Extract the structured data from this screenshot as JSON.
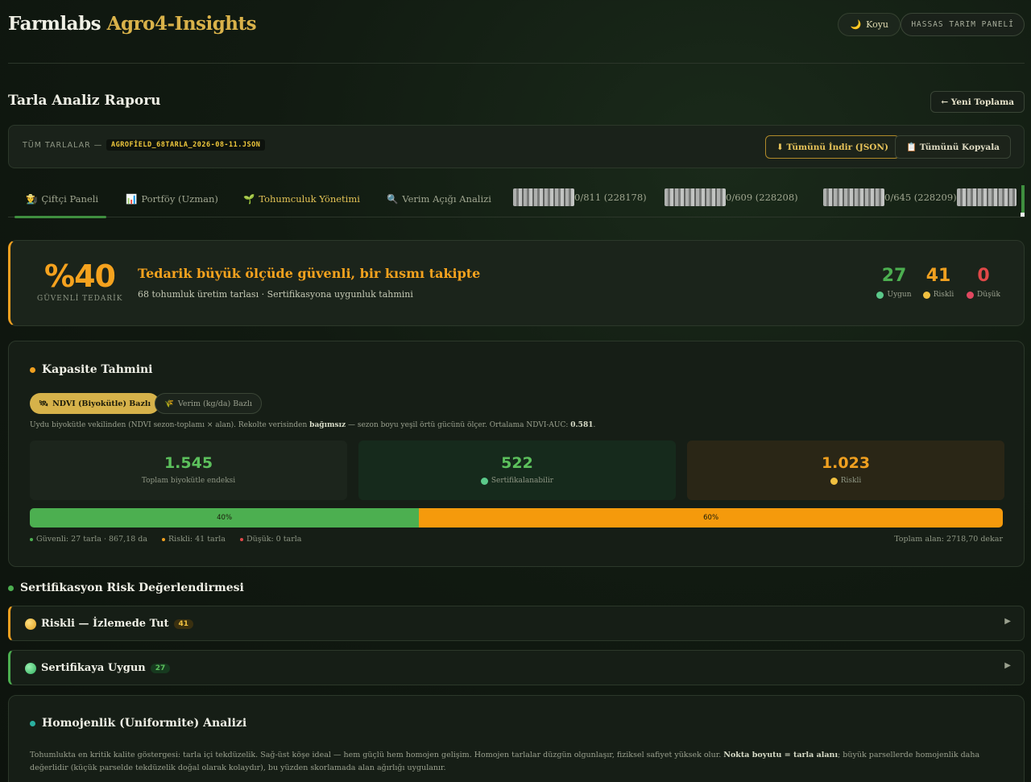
{
  "header": {
    "brand_main": "Farmlabs",
    "brand_accent": "Agro4-Insights",
    "theme_icon": "🌙",
    "theme_label": "Koyu",
    "panel_label": "HASSAS TARIM PANELİ"
  },
  "report": {
    "title": "Tarla Analiz Raporu",
    "new_button": "← Yeni Toplama"
  },
  "filebar": {
    "label": "TÜM TARLALAR —",
    "filename": "AGROFİELD_68TARLA_2026-08-11.JSON",
    "download_button": "⬇ Tümünü İndir (JSON)",
    "copy_button": "📋 Tümünü Kopyala"
  },
  "tabs": [
    {
      "icon": "👨‍🌾",
      "label": "Çiftçi Paneli"
    },
    {
      "icon": "📊",
      "label": "Portföy (Uzman)"
    },
    {
      "icon": "🌱",
      "label": "Tohumculuk Yönetimi"
    },
    {
      "icon": "🔍",
      "label": "Verim Açığı Analizi"
    },
    {
      "label": "0/811 (228178)"
    },
    {
      "label": "0/609 (228208)"
    },
    {
      "label": "0/645 (228209)"
    }
  ],
  "hero": {
    "percent": "%40",
    "percent_label": "GÜVENLİ TEDARİK",
    "headline": "Tedarik büyük ölçüde güvenli, bir kısmı takipte",
    "subline": "68 tohumluk üretim tarlası · Sertifikasyona uygunluk tahmini",
    "stats": [
      {
        "value": "27",
        "label": "Uygun",
        "color": "#4caf50"
      },
      {
        "value": "41",
        "label": "Riskli",
        "color": "#f0a020"
      },
      {
        "value": "0",
        "label": "Düşük",
        "color": "#e04848"
      }
    ]
  },
  "capacity": {
    "title": "Kapasite Tahmini",
    "toggle_on_icon": "🛰",
    "toggle_on": "NDVI (Biyokütle) Bazlı",
    "toggle_off_icon": "🌾",
    "toggle_off": "Verim (kg/da) Bazlı",
    "desc_a": "Uydu biyokütle vekilinden (NDVI sezon-toplamı × alan). Rekolte verisinden ",
    "desc_b": "bağımsız",
    "desc_c": " — sezon boyu yeşil örtü gücünü ölçer. Ortalama NDVI-AUC: ",
    "desc_d": "0.581",
    "desc_e": ".",
    "kpis": [
      {
        "value": "1.545",
        "label": "Toplam biyokütle endeksi"
      },
      {
        "value": "522",
        "label": "Sertifikalanabilir"
      },
      {
        "value": "1.023",
        "label": "Riskli"
      }
    ],
    "bar": [
      {
        "label": "40%",
        "fraction": 0.4,
        "color": "#4caf50"
      },
      {
        "label": "60%",
        "fraction": 0.6,
        "color": "#f59a0c"
      }
    ],
    "legend": [
      {
        "text": "Güvenli: 27 tarla · 867,18 da",
        "color": "#4caf50"
      },
      {
        "text": "Riskli: 41 tarla",
        "color": "#f0a020"
      },
      {
        "text": "Düşük: 0 tarla",
        "color": "#e04848"
      }
    ],
    "total_area": "Toplam alan: 2718,70 dekar"
  },
  "risk": {
    "title": "Sertifikasyon Risk Değerlendirmesi",
    "groups": [
      {
        "label": "Riskli — İzlemede Tut",
        "count": "41",
        "arrow": "▶"
      },
      {
        "label": "Sertifikaya Uygun",
        "count": "27",
        "arrow": "▶"
      }
    ]
  },
  "uniformity": {
    "title": "Homojenlik (Uniformite) Analizi",
    "desc_a": "Tohumlukta en kritik kalite göstergesi: tarla içi tekdüzelik. Sağ-üst köşe ideal — hem güçlü hem homojen gelişim. Homojen tarlalar düzgün olgunlaşır, fiziksel safiyet yüksek olur. ",
    "desc_b": "Nokta boyutu = tarla alanı",
    "desc_c": "; büyük parsellerde homojenlik daha değerlidir (küçük parselde tekdüzelik doğal olarak kolaydır), bu yüzden skorlamada alan ağırlığı uygulanır."
  }
}
